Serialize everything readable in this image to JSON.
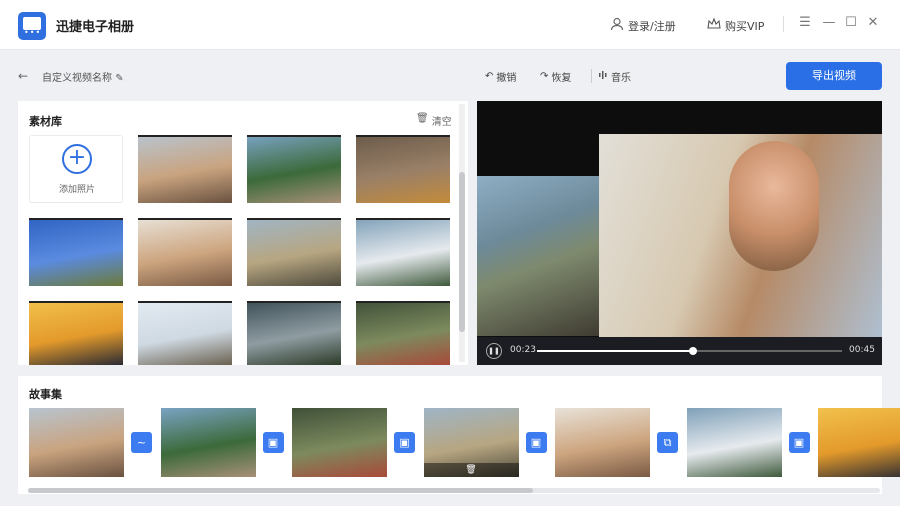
{
  "app": {
    "title": "迅捷电子相册",
    "login": "登录/注册",
    "vip": "购买VIP"
  },
  "toolbar": {
    "back": "←",
    "project_name": "自定义视频名称",
    "undo": "撤销",
    "redo": "恢复",
    "music": "音乐",
    "export": "导出视频"
  },
  "library": {
    "title": "素材库",
    "clear": "清空",
    "add_label": "添加照片",
    "thumbs": [
      {
        "name": "photo-woman-camera",
        "colors": [
          "#b8c4cf",
          "#c9a37f",
          "#6a5240"
        ]
      },
      {
        "name": "photo-street-people",
        "colors": [
          "#7aa3c4",
          "#3c6a3a",
          "#a89078"
        ]
      },
      {
        "name": "photo-rail-boots",
        "colors": [
          "#6b5b4a",
          "#9a8067",
          "#c48b3a"
        ]
      },
      {
        "name": "photo-dog-sky",
        "colors": [
          "#2f63c2",
          "#5a8be0",
          "#6c7a3a"
        ]
      },
      {
        "name": "photo-girl-glasses",
        "colors": [
          "#e8e2d8",
          "#cda57f",
          "#7a5a44"
        ]
      },
      {
        "name": "photo-car-girl",
        "colors": [
          "#9fb5c6",
          "#b7a681",
          "#4e4a3c"
        ]
      },
      {
        "name": "photo-couple-veil",
        "colors": [
          "#7fa0b8",
          "#e6eaee",
          "#3f5a3c"
        ]
      },
      {
        "name": "photo-sunset-rock",
        "colors": [
          "#f2c14d",
          "#e39a2b",
          "#2b2b33"
        ]
      },
      {
        "name": "photo-beach-jump",
        "colors": [
          "#e3ebf2",
          "#cfd9e2",
          "#6a6150"
        ]
      },
      {
        "name": "photo-woman-field",
        "colors": [
          "#3d4f57",
          "#8f9da2",
          "#2c3a28"
        ]
      },
      {
        "name": "photo-forest-kimono",
        "colors": [
          "#3f5038",
          "#7d8a5e",
          "#a84a3a"
        ]
      }
    ]
  },
  "player": {
    "current_time": "00:23",
    "total_time": "00:45",
    "progress": 0.51
  },
  "story": {
    "title": "故事集",
    "clips": [
      {
        "name": "clip-1",
        "colors": [
          "#b8c4cf",
          "#c9a37f",
          "#6a5240"
        ],
        "transition": "~"
      },
      {
        "name": "clip-2",
        "colors": [
          "#7aa3c4",
          "#3c6a3a",
          "#a89078"
        ],
        "transition": "▣"
      },
      {
        "name": "clip-3",
        "colors": [
          "#3f5038",
          "#7d8a5e",
          "#a84a3a"
        ],
        "transition": "▣"
      },
      {
        "name": "clip-4",
        "colors": [
          "#9fb5c6",
          "#b7a681",
          "#4e4a3c"
        ],
        "transition": "▣",
        "delete": "🗑"
      },
      {
        "name": "clip-5",
        "colors": [
          "#e8e2d8",
          "#cda57f",
          "#7a5a44"
        ],
        "transition": "⧉"
      },
      {
        "name": "clip-6",
        "colors": [
          "#7fa0b8",
          "#e6eaee",
          "#3f5a3c"
        ],
        "transition": "▣"
      },
      {
        "name": "clip-7",
        "colors": [
          "#f2c14d",
          "#e39a2b",
          "#2b2b33"
        ]
      }
    ]
  },
  "colors": {
    "accent": "#2b6fe6"
  }
}
